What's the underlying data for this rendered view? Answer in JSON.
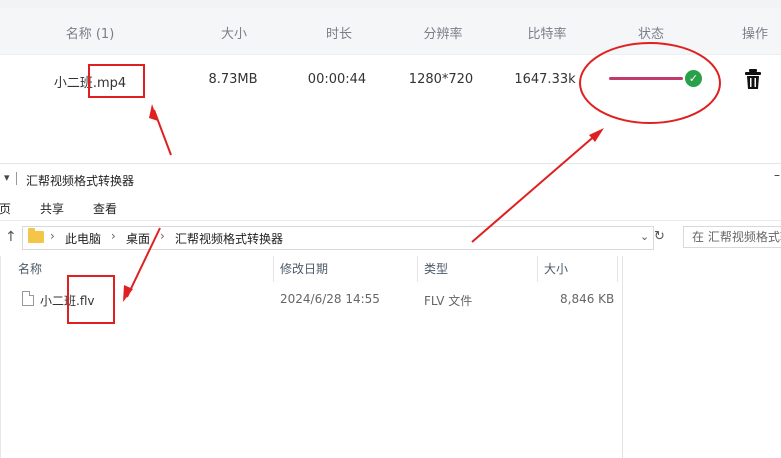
{
  "converter": {
    "headers": {
      "name": "名称 (1)",
      "size": "大小",
      "duration": "时长",
      "resolution": "分辨率",
      "bitrate": "比特率",
      "status": "状态",
      "action": "操作"
    },
    "row": {
      "name": "小二班.mp4",
      "size": "8.73MB",
      "duration": "00:00:44",
      "resolution": "1280*720",
      "bitrate": "1647.33k",
      "progress": 1.0,
      "status_icon": "check-circle-icon",
      "action_icon": "trash-icon"
    },
    "colors": {
      "progress": "#c23a6b",
      "done": "#2aa04a"
    }
  },
  "explorer": {
    "title": "汇帮视频格式转换器",
    "ribbon": [
      "页",
      "共享",
      "查看"
    ],
    "breadcrumb": [
      "此电脑",
      "桌面",
      "汇帮视频格式转换器"
    ],
    "search_placeholder": "在 汇帮视频格式转换器",
    "columns": [
      "名称",
      "修改日期",
      "类型",
      "大小"
    ],
    "files": [
      {
        "name": "小二班.flv",
        "modified": "2024/6/28 14:55",
        "type": "FLV 文件",
        "size": "8,846 KB"
      }
    ]
  },
  "annotations": {
    "color": "#e02020"
  }
}
